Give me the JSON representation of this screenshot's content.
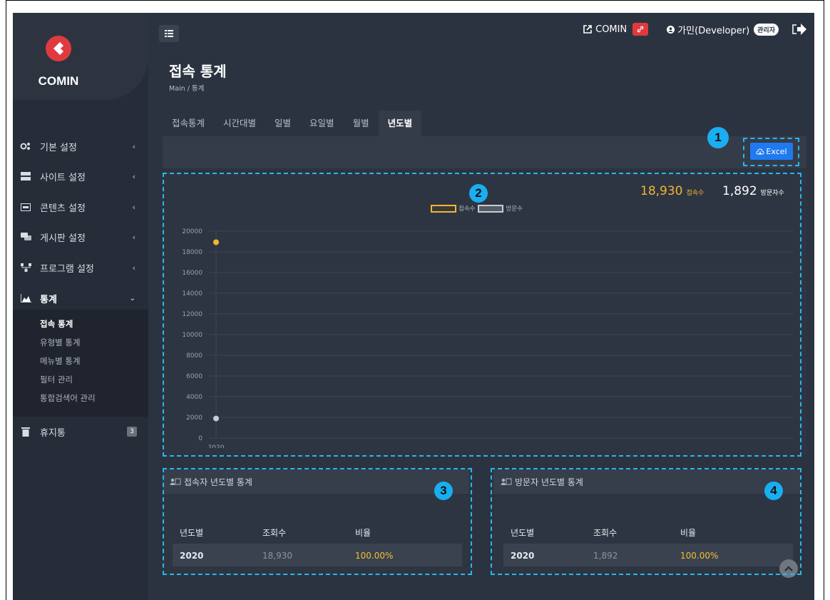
{
  "brand": {
    "name": "COMIN"
  },
  "sidebar": {
    "items": [
      {
        "label": "기본 설정",
        "icon": "gears-icon"
      },
      {
        "label": "사이트 설정",
        "icon": "server-icon"
      },
      {
        "label": "콘텐츠 설정",
        "icon": "content-icon"
      },
      {
        "label": "게시판 설정",
        "icon": "comments-icon"
      },
      {
        "label": "프로그램 설정",
        "icon": "sitemap-icon"
      },
      {
        "label": "통계",
        "icon": "area-chart-icon"
      },
      {
        "label": "휴지통",
        "icon": "trash-icon",
        "badge": "3"
      }
    ],
    "stats_submenu": [
      "접속 통계",
      "유형별 통계",
      "메뉴별 통계",
      "필터 관리",
      "통합검색어 관리"
    ]
  },
  "header": {
    "site_link": "COMIN",
    "user": "가민(Developer)",
    "role": "관리자"
  },
  "page": {
    "title": "접속 통계",
    "breadcrumb": "Main  /  통계"
  },
  "tabs": [
    "접속통계",
    "시간대별",
    "일별",
    "요일별",
    "월별",
    "년도별"
  ],
  "toolbar": {
    "excel_label": "Excel"
  },
  "stats": {
    "visits_value": "18,930",
    "visits_label": "접속수",
    "visitors_value": "1,892",
    "visitors_label": "방문자수"
  },
  "annotations": [
    "1",
    "2",
    "3",
    "4"
  ],
  "colors": {
    "accent_yellow": "#f2b630",
    "visitor_gray": "#c8ccd2",
    "excel_blue": "#1f7af0",
    "dash_cyan": "#27b7ef"
  },
  "chart_data": {
    "type": "scatter",
    "categories": [
      "2020"
    ],
    "series": [
      {
        "name": "접속수",
        "values": [
          18930
        ]
      },
      {
        "name": "방문수",
        "values": [
          1892
        ]
      }
    ],
    "yticks": [
      "0",
      "2000",
      "4000",
      "6000",
      "8000",
      "10000",
      "12000",
      "14000",
      "16000",
      "18000",
      "20000"
    ],
    "ylim": [
      0,
      20000
    ],
    "grid": true,
    "legend": "top-center"
  },
  "tables": {
    "visits": {
      "title": "접속자 년도별 통계",
      "headers": [
        "년도별",
        "조회수",
        "비율"
      ],
      "rows": [
        [
          "2020",
          "18,930",
          "100.00%"
        ]
      ]
    },
    "visitors": {
      "title": "방문자 년도별 통계",
      "headers": [
        "년도별",
        "조회수",
        "비율"
      ],
      "rows": [
        [
          "2020",
          "1,892",
          "100.00%"
        ]
      ]
    }
  }
}
